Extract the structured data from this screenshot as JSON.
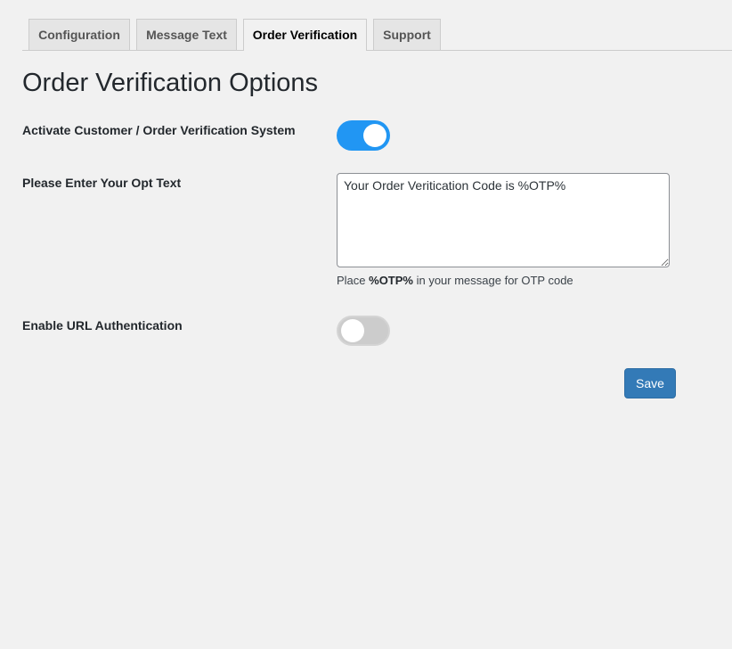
{
  "tabs": [
    {
      "label": "Configuration",
      "active": false
    },
    {
      "label": "Message Text",
      "active": false
    },
    {
      "label": "Order Verification",
      "active": true
    },
    {
      "label": "Support",
      "active": false
    }
  ],
  "title": "Order Verification Options",
  "fields": {
    "activate": {
      "label": "Activate Customer / Order Verification System",
      "enabled": true
    },
    "otp_text": {
      "label": "Please Enter Your Opt Text",
      "value": "Your Order Veritication Code is %OTP%"
    },
    "hint": {
      "prefix": "Place ",
      "token": "%OTP%",
      "suffix": " in your message for OTP code"
    },
    "url_auth": {
      "label": "Enable URL Authentication",
      "enabled": false
    }
  },
  "save_label": "Save",
  "colors": {
    "accent": "#2196f3",
    "toggle_off": "#cccccc",
    "button": "#337ab7",
    "background": "#f1f1f1"
  }
}
